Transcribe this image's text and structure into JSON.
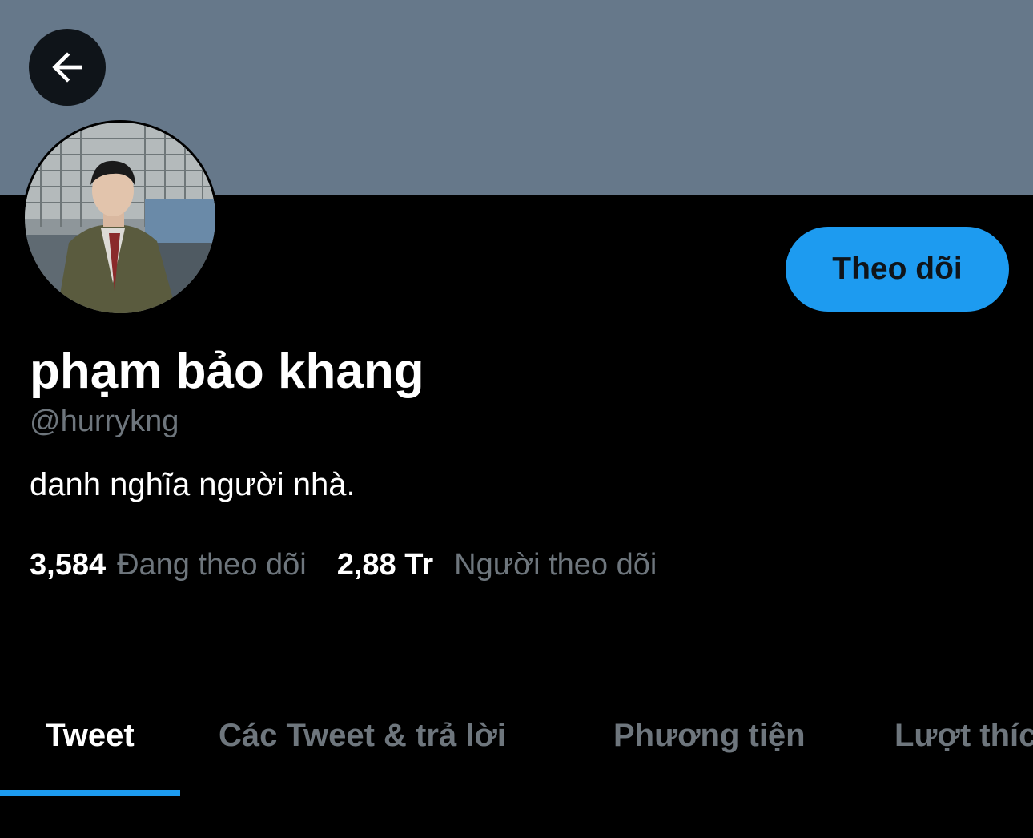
{
  "header": {
    "back_icon": "arrow-left-icon",
    "banner_color": "#66788a"
  },
  "profile": {
    "display_name": "phạm bảo khang",
    "handle": "@hurrykng",
    "bio": "danh nghĩa người nhà.",
    "follow_button_label": "Theo dõi",
    "following_count": "3,584",
    "following_label": "Đang theo dõi",
    "followers_count": "2,88 Tr",
    "followers_label": "Người theo dõi"
  },
  "tabs": [
    {
      "label": "Tweet",
      "active": true
    },
    {
      "label": "Các Tweet & trả lời",
      "active": false
    },
    {
      "label": "Phương tiện",
      "active": false
    },
    {
      "label": "Lượt thích",
      "active": false
    }
  ],
  "colors": {
    "accent": "#1d9bf0",
    "background": "#000000",
    "muted_text": "#6e767d"
  }
}
